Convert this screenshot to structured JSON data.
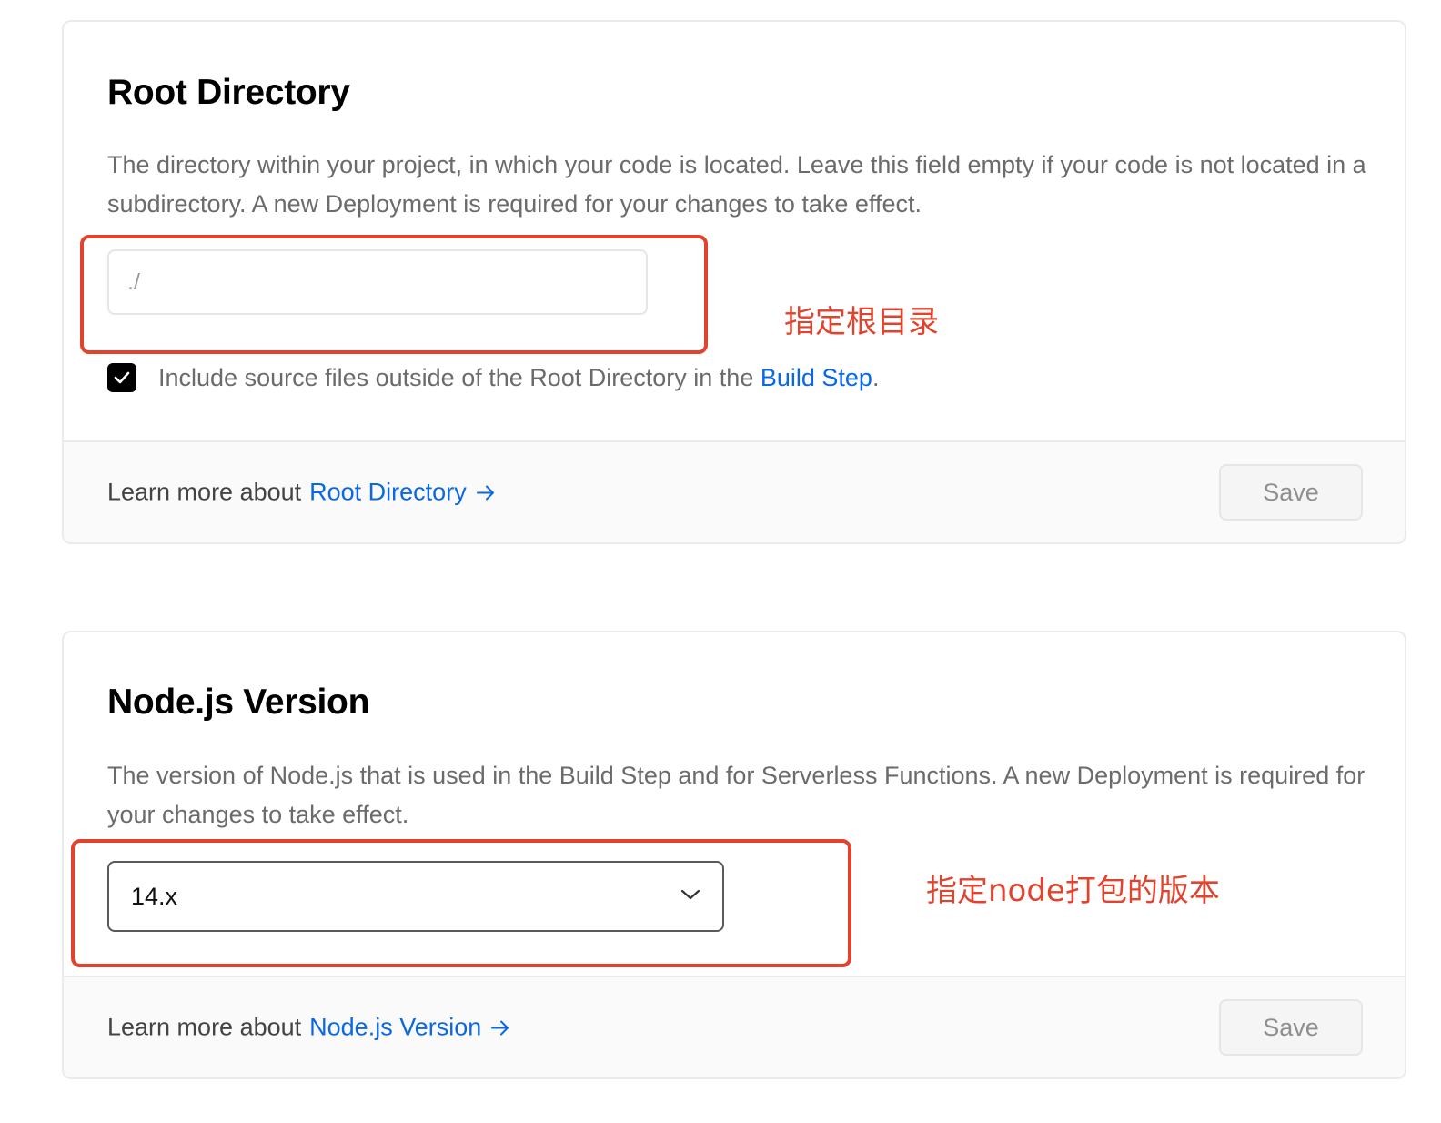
{
  "root_directory": {
    "title": "Root Directory",
    "description": "The directory within your project, in which your code is located. Leave this field empty if your code is not located in a subdirectory. A new Deployment is required for your changes to take effect.",
    "input_placeholder": "./",
    "input_value": "",
    "checkbox_checked": true,
    "checkbox_label_prefix": "Include source files outside of the Root Directory in the",
    "checkbox_link": "Build Step",
    "checkbox_label_suffix": ".",
    "footer_prefix": "Learn more about",
    "footer_link": "Root Directory",
    "save_label": "Save"
  },
  "node_version": {
    "title": "Node.js Version",
    "description": "The version of Node.js that is used in the Build Step and for Serverless Functions. A new Deployment is required for your changes to take effect.",
    "selected_value": "14.x",
    "footer_prefix": "Learn more about",
    "footer_link": "Node.js Version",
    "save_label": "Save"
  },
  "annotations": {
    "root": "指定根目录",
    "node": "指定node打包的版本",
    "color": "#e2432e"
  },
  "colors": {
    "link": "#0a68e6",
    "checkbox": "#000000"
  },
  "icons": {
    "checkbox": "check-icon",
    "select": "chevron-down-icon",
    "footer_link": "arrow-right-icon"
  }
}
